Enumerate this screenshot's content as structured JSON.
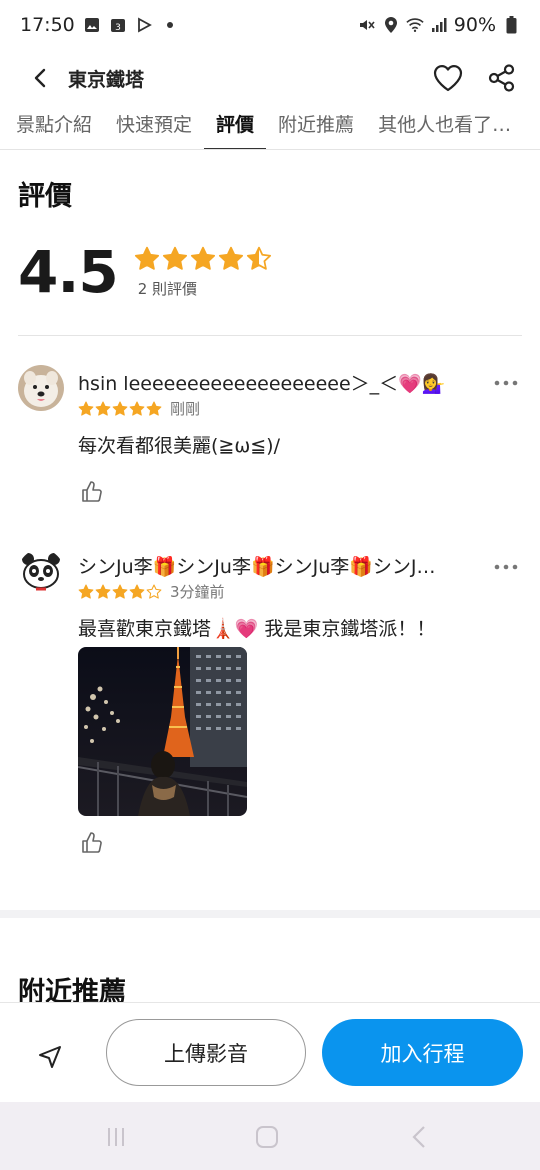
{
  "status_bar": {
    "time": "17:50",
    "battery": "90%"
  },
  "header": {
    "title": "東京鐵塔"
  },
  "tabs": [
    {
      "label": "景點介紹"
    },
    {
      "label": "快速預定"
    },
    {
      "label": "評價"
    },
    {
      "label": "附近推薦"
    },
    {
      "label": "其他人也看了…"
    }
  ],
  "reviews_section": {
    "title": "評價",
    "rating": "4.5",
    "rating_value": 4.5,
    "count_label": "2 則評價"
  },
  "reviews": [
    {
      "name": "hsin leeeeeeeeeeeeeeeeeee＞_＜💗💁‍♀️",
      "stars": 5,
      "time": "剛剛",
      "text": "每次看都很美麗(≧ω≦)/"
    },
    {
      "name": "シンJu李🎁シンJu李🎁シンJu李🎁シンJ…",
      "stars": 4,
      "time": "3分鐘前",
      "text": "最喜歡東京鐵塔🗼💗 我是東京鐵塔派！！"
    }
  ],
  "next_section": {
    "title": "附近推薦"
  },
  "bottom_actions": {
    "upload_label": "上傳影音",
    "add_label": "加入行程"
  },
  "colors": {
    "star": "#f5a623",
    "primary": "#0a94ee"
  }
}
